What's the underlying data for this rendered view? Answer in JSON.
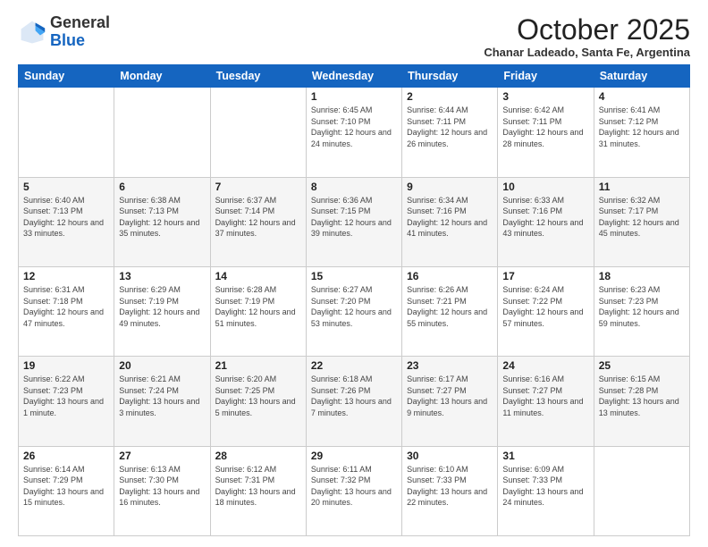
{
  "header": {
    "logo_general": "General",
    "logo_blue": "Blue",
    "month_title": "October 2025",
    "subtitle": "Chanar Ladeado, Santa Fe, Argentina"
  },
  "days_of_week": [
    "Sunday",
    "Monday",
    "Tuesday",
    "Wednesday",
    "Thursday",
    "Friday",
    "Saturday"
  ],
  "weeks": [
    [
      {
        "day": "",
        "info": ""
      },
      {
        "day": "",
        "info": ""
      },
      {
        "day": "",
        "info": ""
      },
      {
        "day": "1",
        "info": "Sunrise: 6:45 AM\nSunset: 7:10 PM\nDaylight: 12 hours\nand 24 minutes."
      },
      {
        "day": "2",
        "info": "Sunrise: 6:44 AM\nSunset: 7:11 PM\nDaylight: 12 hours\nand 26 minutes."
      },
      {
        "day": "3",
        "info": "Sunrise: 6:42 AM\nSunset: 7:11 PM\nDaylight: 12 hours\nand 28 minutes."
      },
      {
        "day": "4",
        "info": "Sunrise: 6:41 AM\nSunset: 7:12 PM\nDaylight: 12 hours\nand 31 minutes."
      }
    ],
    [
      {
        "day": "5",
        "info": "Sunrise: 6:40 AM\nSunset: 7:13 PM\nDaylight: 12 hours\nand 33 minutes."
      },
      {
        "day": "6",
        "info": "Sunrise: 6:38 AM\nSunset: 7:13 PM\nDaylight: 12 hours\nand 35 minutes."
      },
      {
        "day": "7",
        "info": "Sunrise: 6:37 AM\nSunset: 7:14 PM\nDaylight: 12 hours\nand 37 minutes."
      },
      {
        "day": "8",
        "info": "Sunrise: 6:36 AM\nSunset: 7:15 PM\nDaylight: 12 hours\nand 39 minutes."
      },
      {
        "day": "9",
        "info": "Sunrise: 6:34 AM\nSunset: 7:16 PM\nDaylight: 12 hours\nand 41 minutes."
      },
      {
        "day": "10",
        "info": "Sunrise: 6:33 AM\nSunset: 7:16 PM\nDaylight: 12 hours\nand 43 minutes."
      },
      {
        "day": "11",
        "info": "Sunrise: 6:32 AM\nSunset: 7:17 PM\nDaylight: 12 hours\nand 45 minutes."
      }
    ],
    [
      {
        "day": "12",
        "info": "Sunrise: 6:31 AM\nSunset: 7:18 PM\nDaylight: 12 hours\nand 47 minutes."
      },
      {
        "day": "13",
        "info": "Sunrise: 6:29 AM\nSunset: 7:19 PM\nDaylight: 12 hours\nand 49 minutes."
      },
      {
        "day": "14",
        "info": "Sunrise: 6:28 AM\nSunset: 7:19 PM\nDaylight: 12 hours\nand 51 minutes."
      },
      {
        "day": "15",
        "info": "Sunrise: 6:27 AM\nSunset: 7:20 PM\nDaylight: 12 hours\nand 53 minutes."
      },
      {
        "day": "16",
        "info": "Sunrise: 6:26 AM\nSunset: 7:21 PM\nDaylight: 12 hours\nand 55 minutes."
      },
      {
        "day": "17",
        "info": "Sunrise: 6:24 AM\nSunset: 7:22 PM\nDaylight: 12 hours\nand 57 minutes."
      },
      {
        "day": "18",
        "info": "Sunrise: 6:23 AM\nSunset: 7:23 PM\nDaylight: 12 hours\nand 59 minutes."
      }
    ],
    [
      {
        "day": "19",
        "info": "Sunrise: 6:22 AM\nSunset: 7:23 PM\nDaylight: 13 hours\nand 1 minute."
      },
      {
        "day": "20",
        "info": "Sunrise: 6:21 AM\nSunset: 7:24 PM\nDaylight: 13 hours\nand 3 minutes."
      },
      {
        "day": "21",
        "info": "Sunrise: 6:20 AM\nSunset: 7:25 PM\nDaylight: 13 hours\nand 5 minutes."
      },
      {
        "day": "22",
        "info": "Sunrise: 6:18 AM\nSunset: 7:26 PM\nDaylight: 13 hours\nand 7 minutes."
      },
      {
        "day": "23",
        "info": "Sunrise: 6:17 AM\nSunset: 7:27 PM\nDaylight: 13 hours\nand 9 minutes."
      },
      {
        "day": "24",
        "info": "Sunrise: 6:16 AM\nSunset: 7:27 PM\nDaylight: 13 hours\nand 11 minutes."
      },
      {
        "day": "25",
        "info": "Sunrise: 6:15 AM\nSunset: 7:28 PM\nDaylight: 13 hours\nand 13 minutes."
      }
    ],
    [
      {
        "day": "26",
        "info": "Sunrise: 6:14 AM\nSunset: 7:29 PM\nDaylight: 13 hours\nand 15 minutes."
      },
      {
        "day": "27",
        "info": "Sunrise: 6:13 AM\nSunset: 7:30 PM\nDaylight: 13 hours\nand 16 minutes."
      },
      {
        "day": "28",
        "info": "Sunrise: 6:12 AM\nSunset: 7:31 PM\nDaylight: 13 hours\nand 18 minutes."
      },
      {
        "day": "29",
        "info": "Sunrise: 6:11 AM\nSunset: 7:32 PM\nDaylight: 13 hours\nand 20 minutes."
      },
      {
        "day": "30",
        "info": "Sunrise: 6:10 AM\nSunset: 7:33 PM\nDaylight: 13 hours\nand 22 minutes."
      },
      {
        "day": "31",
        "info": "Sunrise: 6:09 AM\nSunset: 7:33 PM\nDaylight: 13 hours\nand 24 minutes."
      },
      {
        "day": "",
        "info": ""
      }
    ]
  ]
}
